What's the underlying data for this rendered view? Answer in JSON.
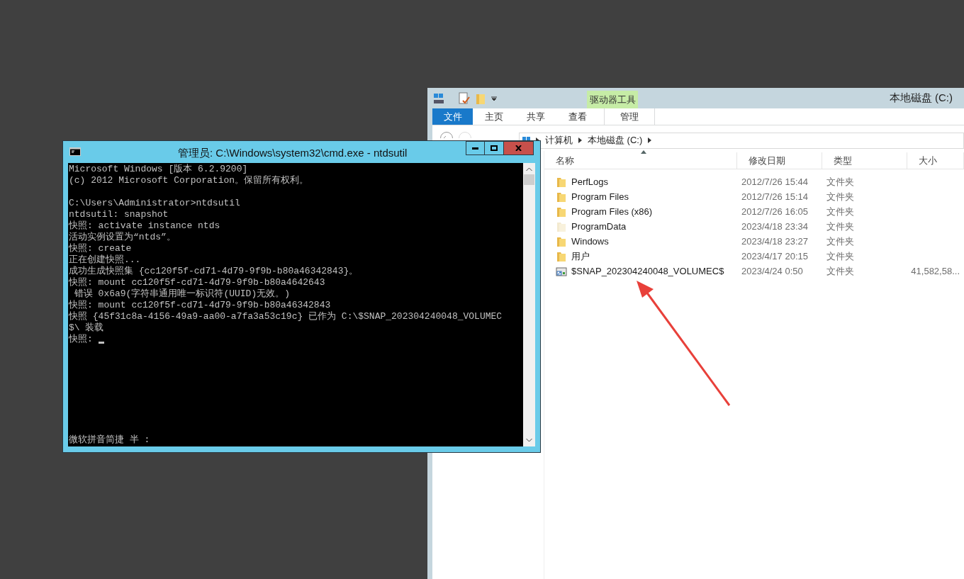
{
  "explorer": {
    "title": "本地磁盘 (C:)",
    "context_tab": "驱动器工具",
    "tabs": [
      {
        "label": "文件",
        "selected": true
      },
      {
        "label": "主页",
        "selected": false
      },
      {
        "label": "共享",
        "selected": false
      },
      {
        "label": "查看",
        "selected": false
      },
      {
        "label": "管理",
        "selected": false
      }
    ],
    "breadcrumb": [
      "计算机",
      "本地磁盘 (C:)"
    ],
    "columns": [
      "名称",
      "修改日期",
      "类型",
      "大小"
    ],
    "rows": [
      {
        "kind": "folder",
        "name": "PerfLogs",
        "date": "2012/7/26 15:44",
        "type": "文件夹"
      },
      {
        "kind": "folder",
        "name": "Program Files",
        "date": "2012/7/26 15:14",
        "type": "文件夹"
      },
      {
        "kind": "folder",
        "name": "Program Files (x86)",
        "date": "2012/7/26 16:05",
        "type": "文件夹"
      },
      {
        "kind": "hidden",
        "name": "ProgramData",
        "date": "2023/4/18 23:34",
        "type": "文件夹"
      },
      {
        "kind": "folder",
        "name": "Windows",
        "date": "2023/4/18 23:27",
        "type": "文件夹"
      },
      {
        "kind": "folder",
        "name": "用户",
        "date": "2023/4/17 20:15",
        "type": "文件夹"
      },
      {
        "kind": "link",
        "name": "$SNAP_202304240048_VOLUMEC$",
        "date": "2023/4/24 0:50",
        "type": "文件夹",
        "size": "41,582,58..."
      }
    ]
  },
  "console": {
    "title": "管理员: C:\\Windows\\system32\\cmd.exe - ntdsutil",
    "blocks": [
      [
        "Microsoft Windows [版本 6.2.9200]",
        "(c) 2012 Microsoft Corporation。保留所有权利。"
      ],
      [
        "C:\\Users\\Administrator>ntdsutil",
        "ntdsutil: snapshot",
        "快照: activate instance ntds",
        "活动实例设置为“ntds”。",
        "快照: create",
        "正在创建快照...",
        "成功生成快照集 {cc120f5f-cd71-4d79-9f9b-b80a46342843}。",
        "快照: mount cc120f5f-cd71-4d79-9f9b-b80a4642643",
        " 错误 0x6a9(字符串通用唯一标识符(UUID)无效。)",
        "快照: mount cc120f5f-cd71-4d79-9f9b-b80a46342843",
        "快照 {45f31c8a-4156-49a9-aa00-a7fa3a53c19c} 已作为 C:\\$SNAP_202304240048_VOLUMEC",
        "$\\ 装载",
        "快照: "
      ]
    ],
    "cursor": true,
    "ime_status": "微软拼音简捷 半 :"
  }
}
